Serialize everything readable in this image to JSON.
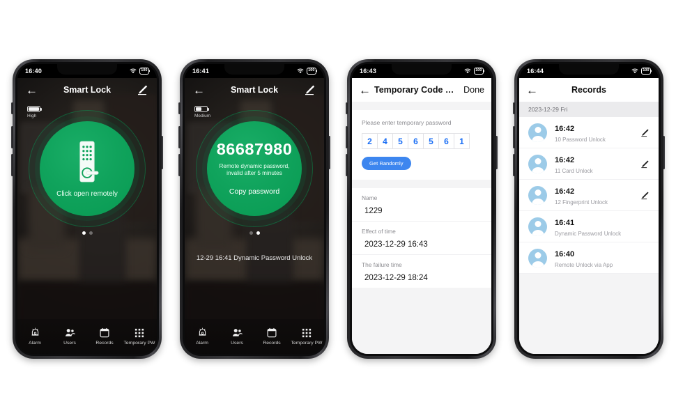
{
  "phones": [
    {
      "id": "phone-smartlock-home",
      "kind": "dark",
      "status": {
        "time": "16:40",
        "wifi_icon": "wifi-icon",
        "battery_icon": "battery-icon",
        "battery_text": "100"
      },
      "nav": {
        "back_icon": "back-arrow-icon",
        "title": "Smart Lock",
        "edit_icon": "pencil-edit-icon"
      },
      "battery_level": {
        "label": "High",
        "fill_percent": 100
      },
      "circle": {
        "icon": "smart-door-lock-icon",
        "cta": "Click open remotely"
      },
      "dots": {
        "count": 2,
        "active": 0
      },
      "recent": "",
      "tabs": [
        {
          "label": "Alarm",
          "icon": "alarm-bell-icon"
        },
        {
          "label": "Users",
          "icon": "users-icon"
        },
        {
          "label": "Records",
          "icon": "calendar-records-icon"
        },
        {
          "label": "Temporary PW",
          "icon": "keypad-grid-icon"
        }
      ]
    },
    {
      "id": "phone-dynamic-password",
      "kind": "dark",
      "status": {
        "time": "16:41",
        "wifi_icon": "wifi-icon",
        "battery_icon": "battery-icon",
        "battery_text": "100"
      },
      "nav": {
        "back_icon": "back-arrow-icon",
        "title": "Smart Lock",
        "edit_icon": "pencil-edit-icon"
      },
      "battery_level": {
        "label": "Medium",
        "fill_percent": 50
      },
      "circle": {
        "code": "86687980",
        "subtitle": "Remote dynamic password, invalid after 5 minutes",
        "cta": "Copy password"
      },
      "dots": {
        "count": 2,
        "active": 1
      },
      "recent": "12-29 16:41  Dynamic Password Unlock",
      "tabs": [
        {
          "label": "Alarm",
          "icon": "alarm-bell-icon"
        },
        {
          "label": "Users",
          "icon": "users-icon"
        },
        {
          "label": "Records",
          "icon": "calendar-records-icon"
        },
        {
          "label": "Temporary PW",
          "icon": "keypad-grid-icon"
        }
      ]
    },
    {
      "id": "phone-temporary-code",
      "kind": "light-form",
      "status": {
        "time": "16:43",
        "wifi_icon": "wifi-icon",
        "battery_icon": "battery-icon",
        "battery_text": "100"
      },
      "nav": {
        "back_icon": "back-arrow-icon",
        "title": "Temporary Code Se...",
        "done_label": "Done"
      },
      "password": {
        "hint": "Please enter temporary password",
        "digits": [
          "2",
          "4",
          "5",
          "6",
          "5",
          "6",
          "1"
        ],
        "random_button": "Get Randomly",
        "digit_color": "#1a6ef5",
        "button_color": "#3d86ef"
      },
      "fields": [
        {
          "label": "Name",
          "value": "1229"
        },
        {
          "label": "Effect of time",
          "value": "2023-12-29 16:43"
        },
        {
          "label": "The failure time",
          "value": "2023-12-29 18:24"
        }
      ]
    },
    {
      "id": "phone-records",
      "kind": "light-records",
      "status": {
        "time": "16:44",
        "wifi_icon": "wifi-icon",
        "battery_icon": "battery-icon",
        "battery_text": "100"
      },
      "nav": {
        "back_icon": "back-arrow-icon",
        "title": "Records"
      },
      "date_header": "2023-12-29 Fri",
      "records": [
        {
          "time": "16:42",
          "desc": "10 Password Unlock",
          "edit_icon": "pencil-edit-icon",
          "has_edit": true
        },
        {
          "time": "16:42",
          "desc": "11 Card Unlock",
          "edit_icon": "pencil-edit-icon",
          "has_edit": true
        },
        {
          "time": "16:42",
          "desc": "12 Fingerprint Unlock",
          "edit_icon": "pencil-edit-icon",
          "has_edit": true
        },
        {
          "time": "16:41",
          "desc": "Dynamic Password Unlock",
          "edit_icon": "pencil-edit-icon",
          "has_edit": false
        },
        {
          "time": "16:40",
          "desc": "Remote Unlock via App",
          "edit_icon": "pencil-edit-icon",
          "has_edit": false
        }
      ]
    }
  ],
  "colors": {
    "green_primary": "#10a35c",
    "blue_digit": "#1a6ef5",
    "blue_button": "#3d86ef",
    "avatar_blue": "#9ccbe8",
    "page_bg": "#ffffff"
  }
}
